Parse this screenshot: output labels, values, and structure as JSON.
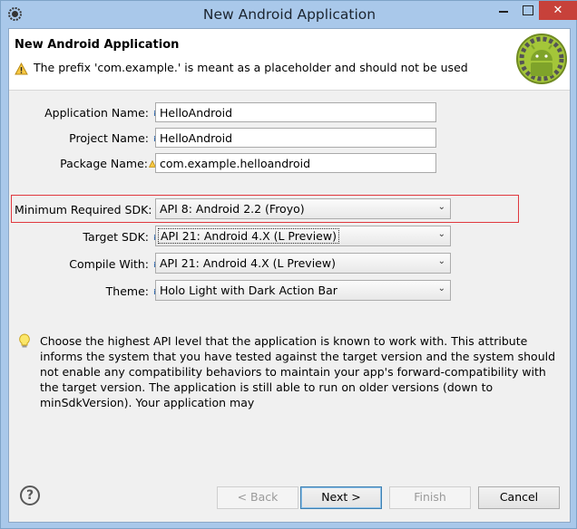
{
  "window": {
    "title": "New Android Application",
    "close_glyph": "✕"
  },
  "header": {
    "title": "New Android Application",
    "warning": "The prefix 'com.example.' is meant as a placeholder and should not be used"
  },
  "fields": {
    "application_name": {
      "label": "Application Name:",
      "value": "HelloAndroid"
    },
    "project_name": {
      "label": "Project Name:",
      "value": "HelloAndroid"
    },
    "package_name": {
      "label": "Package Name:",
      "value": "com.example.helloandroid"
    }
  },
  "combos": {
    "min_sdk": {
      "label": "Minimum Required SDK:",
      "value": "API 8: Android 2.2 (Froyo)"
    },
    "target_sdk": {
      "label": "Target SDK:",
      "value": "API 21: Android 4.X (L Preview)"
    },
    "compile_with": {
      "label": "Compile With:",
      "value": "API 21: Android 4.X (L Preview)"
    },
    "theme": {
      "label": "Theme:",
      "value": "Holo Light with Dark Action Bar"
    }
  },
  "help": {
    "text": "Choose the highest API level that the application is known to work with. This attribute informs the system that you have tested against the target version and the system should not enable any compatibility behaviors to maintain your app's forward-compatibility with the target version. The application is still able to run on older versions (down to minSdkVersion). Your application may"
  },
  "buttons": {
    "help_glyph": "?",
    "back": "< Back",
    "next": "Next >",
    "finish": "Finish",
    "cancel": "Cancel"
  },
  "colors": {
    "accent": "#3c7fb1",
    "highlight": "#e0383e",
    "android_green": "#a4c639"
  }
}
